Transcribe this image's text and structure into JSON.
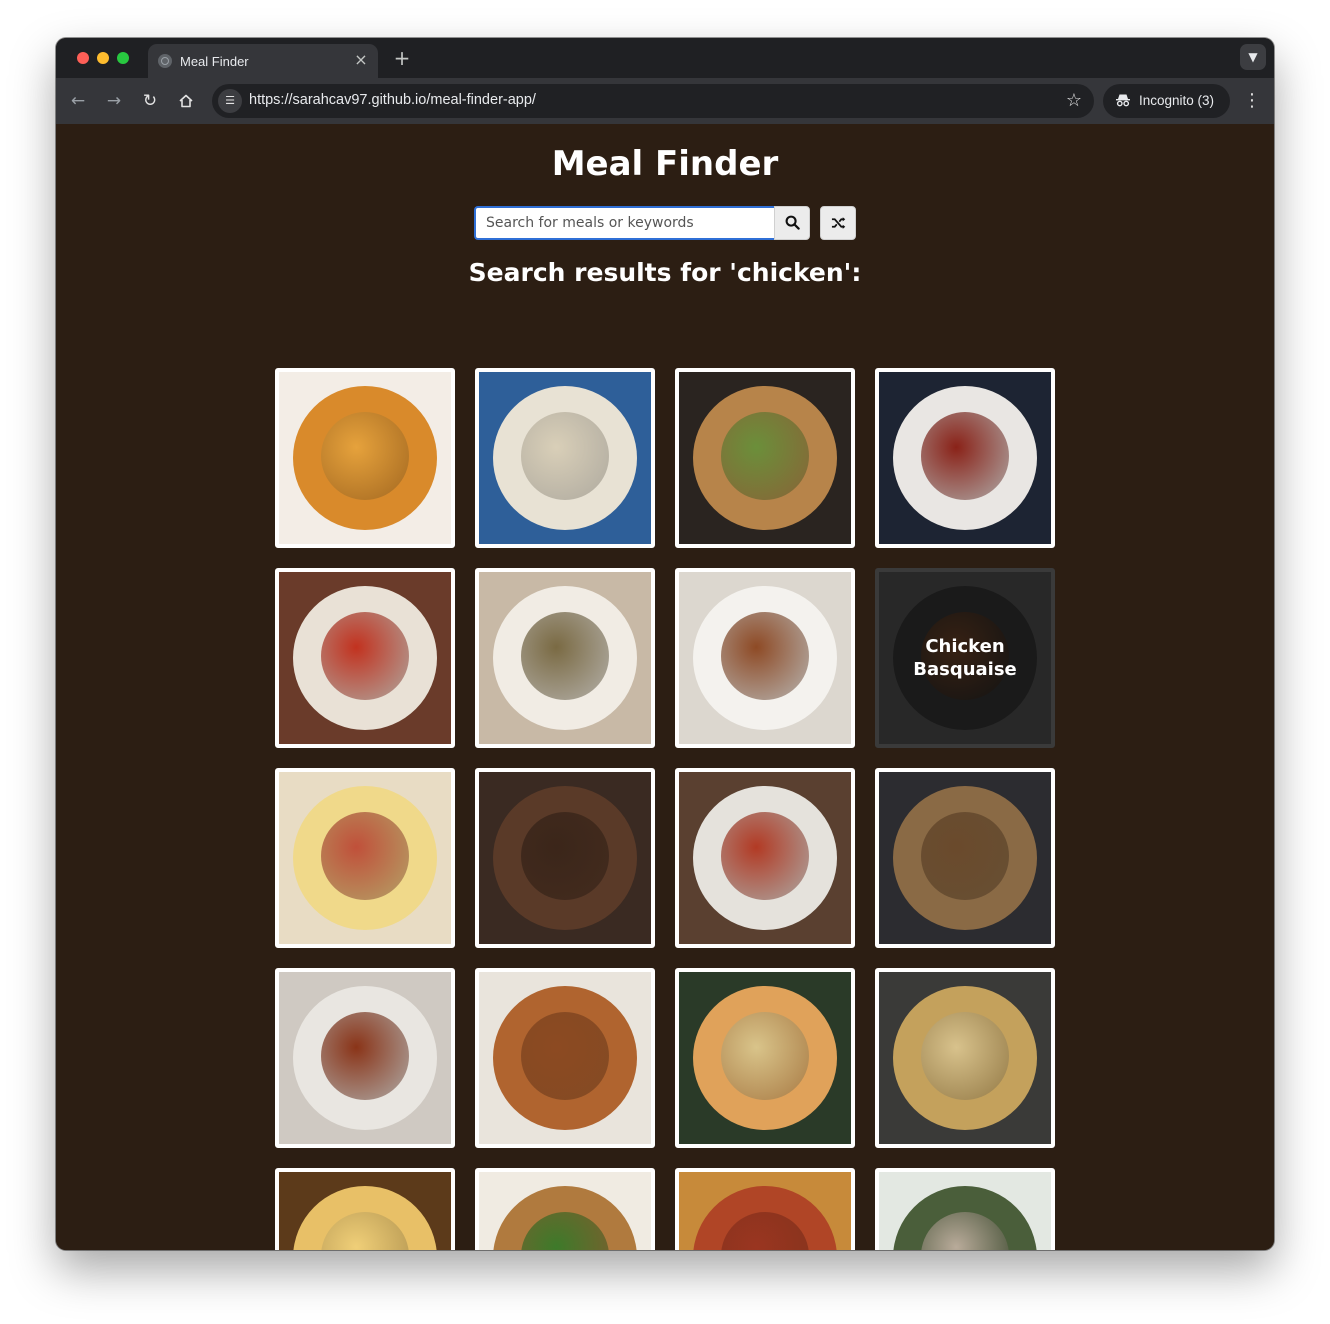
{
  "browser": {
    "tab_title": "Meal Finder",
    "tab_close_glyph": "×",
    "new_tab_glyph": "+",
    "url": "https://sarahcav97.github.io/meal-finder-app/",
    "incognito_label": "Incognito (3)"
  },
  "app": {
    "title": "Meal Finder",
    "search_placeholder": "Search for meals or keywords",
    "search_value": "",
    "search_icon": "search-icon",
    "random_icon": "shuffle-icon",
    "result_heading": "Search results for 'chicken':"
  },
  "meals": [
    {
      "name": "",
      "colors": [
        "#f3ede6",
        "#d98a2b",
        "#e6a23c"
      ]
    },
    {
      "name": "",
      "colors": [
        "#2e5f99",
        "#e8e2d4",
        "#d9cfb8"
      ]
    },
    {
      "name": "",
      "colors": [
        "#2a2420",
        "#b7844a",
        "#6b8f3a"
      ]
    },
    {
      "name": "",
      "colors": [
        "#1d2433",
        "#e9e6e3",
        "#8a2218"
      ]
    },
    {
      "name": "",
      "colors": [
        "#6a3b2a",
        "#e9e1d6",
        "#c2321f"
      ]
    },
    {
      "name": "",
      "colors": [
        "#c8b9a6",
        "#f1ece4",
        "#7a6a43"
      ]
    },
    {
      "name": "",
      "colors": [
        "#dcd7cf",
        "#f4f2ee",
        "#8e4a25"
      ]
    },
    {
      "name": "Chicken Basquaise",
      "colors": [
        "#5a5a5a",
        "#3a3a3a",
        "#7a4a2a"
      ],
      "hover": true
    },
    {
      "name": "",
      "colors": [
        "#e8dcc4",
        "#f0d98a",
        "#c0503a"
      ]
    },
    {
      "name": "",
      "colors": [
        "#3a2a22",
        "#5a3a28",
        "#3b261a"
      ]
    },
    {
      "name": "",
      "colors": [
        "#5a4030",
        "#e5e2dc",
        "#b23a24"
      ]
    },
    {
      "name": "",
      "colors": [
        "#2c2c30",
        "#8a6a45",
        "#6a4a2c"
      ]
    },
    {
      "name": "",
      "colors": [
        "#cfc9c2",
        "#e9e6e1",
        "#8a3418"
      ]
    },
    {
      "name": "",
      "colors": [
        "#e9e4dc",
        "#b0642f",
        "#8c4a22"
      ]
    },
    {
      "name": "",
      "colors": [
        "#2a3a28",
        "#e0a25a",
        "#d9c48a"
      ]
    },
    {
      "name": "",
      "colors": [
        "#3a3a38",
        "#c4a15c",
        "#d8c28c"
      ]
    },
    {
      "name": "",
      "colors": [
        "#5c3a1a",
        "#e8c067",
        "#f0cf78"
      ]
    },
    {
      "name": "",
      "colors": [
        "#f0ebe2",
        "#b07a3e",
        "#3d7a2a"
      ]
    },
    {
      "name": "",
      "colors": [
        "#c78a3a",
        "#b04526",
        "#9a3520"
      ]
    },
    {
      "name": "",
      "colors": [
        "#e3e8e2",
        "#4a5e3a",
        "#b9ab9a"
      ]
    }
  ]
}
